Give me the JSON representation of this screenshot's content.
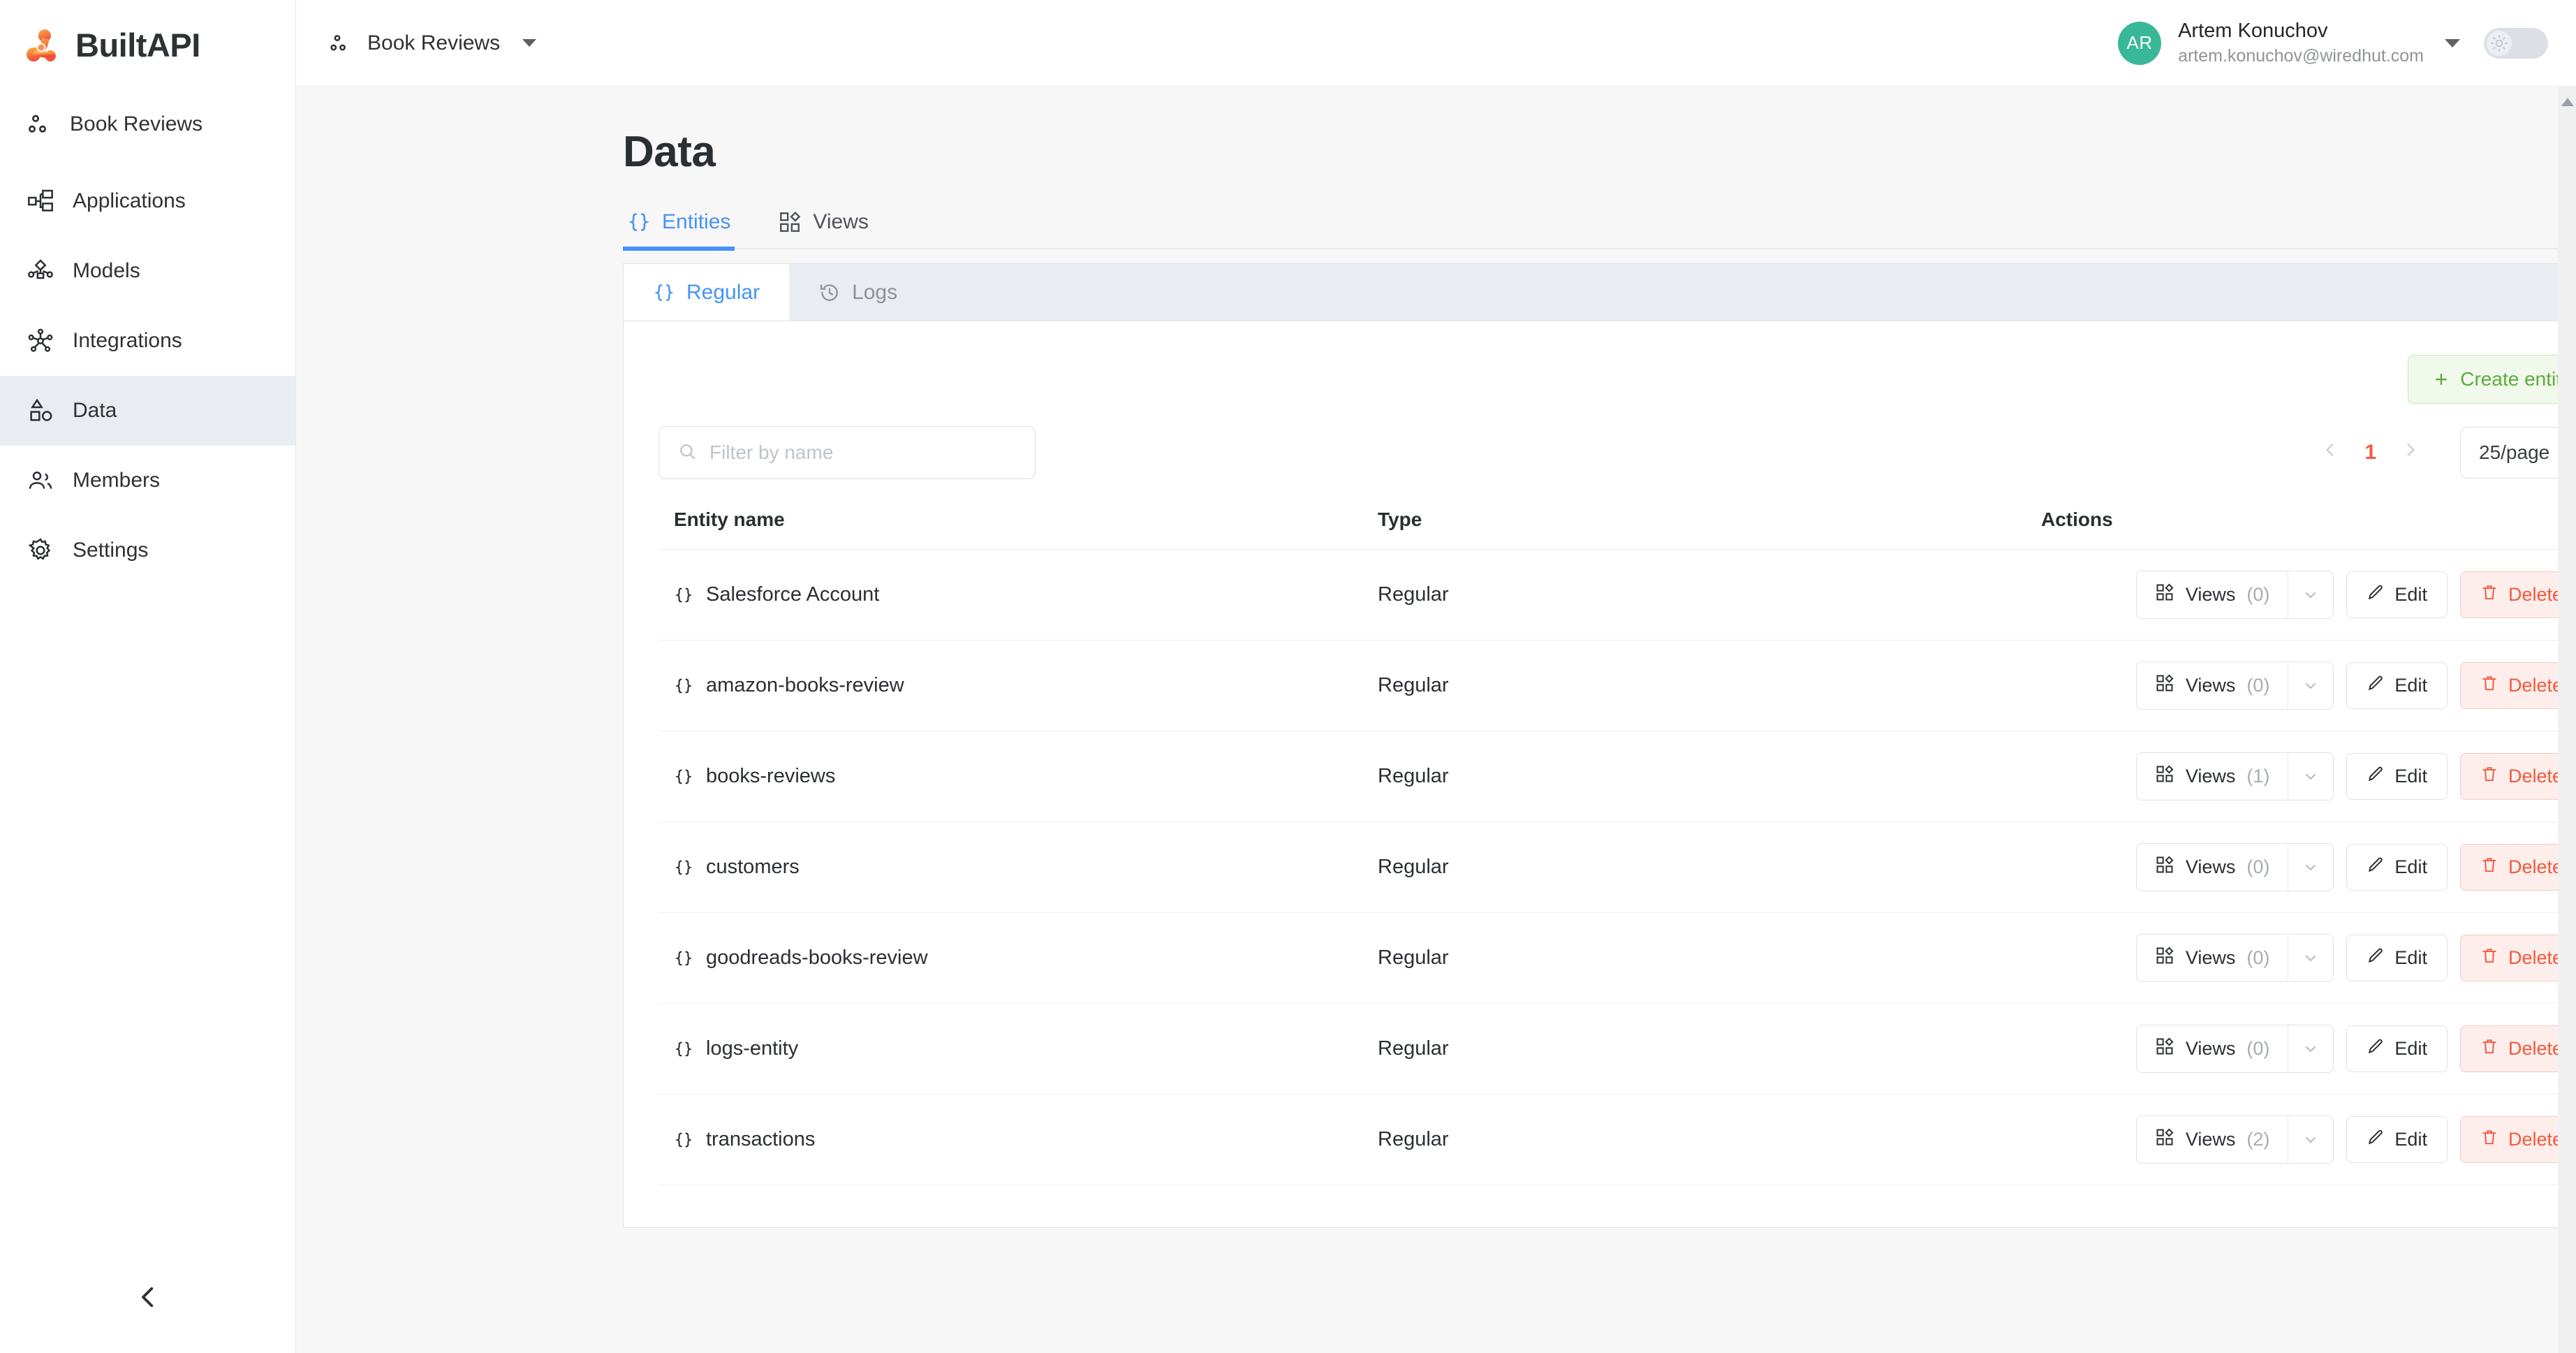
{
  "brand": {
    "name": "BuiltAPI",
    "logo_icon": "molecule-icon"
  },
  "sidebar": {
    "project": {
      "label": "Book Reviews",
      "icon": "nodes-icon"
    },
    "items": [
      {
        "label": "Applications",
        "icon": "applications-icon",
        "active": false
      },
      {
        "label": "Models",
        "icon": "models-icon",
        "active": false
      },
      {
        "label": "Integrations",
        "icon": "integrations-icon",
        "active": false
      },
      {
        "label": "Data",
        "icon": "data-icon",
        "active": true
      },
      {
        "label": "Members",
        "icon": "members-icon",
        "active": false
      },
      {
        "label": "Settings",
        "icon": "gear-icon",
        "active": false
      }
    ],
    "collapse_icon": "chevron-left-icon"
  },
  "topbar": {
    "project_switcher": {
      "label": "Book Reviews",
      "icon": "nodes-icon",
      "caret": "caret-down-icon"
    },
    "user": {
      "initials": "AR",
      "name": "Artem Konuchov",
      "email": "artem.konuchov@wiredhut.com",
      "avatar_color": "#38b897",
      "caret": "caret-down-icon"
    },
    "theme_toggle": {
      "icon": "sun-icon",
      "state": "off"
    }
  },
  "page": {
    "title": "Data",
    "tabs": [
      {
        "label": "Entities",
        "icon": "braces-icon",
        "active": true
      },
      {
        "label": "Views",
        "icon": "grid-icon",
        "active": false
      }
    ],
    "subtabs": [
      {
        "label": "Regular",
        "icon": "braces-icon",
        "active": true
      },
      {
        "label": "Logs",
        "icon": "history-icon",
        "active": false
      }
    ]
  },
  "toolbar": {
    "create_label": "Create entity",
    "create_plus": "+",
    "search": {
      "placeholder": "Filter by name",
      "value": "",
      "icon": "search-icon"
    },
    "pagination": {
      "prev_icon": "chevron-left-icon",
      "next_icon": "chevron-right-icon",
      "current_page": "1",
      "page_size": "25/page",
      "page_size_caret": "chevron-down-icon"
    }
  },
  "table": {
    "columns": [
      "Entity name",
      "Type",
      "Actions"
    ],
    "action_labels": {
      "views": "Views",
      "edit": "Edit",
      "delete": "Delete"
    },
    "rows": [
      {
        "name": "Salesforce Account",
        "type": "Regular",
        "views": "(0)"
      },
      {
        "name": "amazon-books-review",
        "type": "Regular",
        "views": "(0)"
      },
      {
        "name": "books-reviews",
        "type": "Regular",
        "views": "(1)"
      },
      {
        "name": "customers",
        "type": "Regular",
        "views": "(0)"
      },
      {
        "name": "goodreads-books-review",
        "type": "Regular",
        "views": "(0)"
      },
      {
        "name": "logs-entity",
        "type": "Regular",
        "views": "(0)"
      },
      {
        "name": "transactions",
        "type": "Regular",
        "views": "(2)"
      }
    ]
  },
  "colors": {
    "accent_blue": "#4593f5",
    "accent_orange": "#f05a3c",
    "success_green": "#5daa3d",
    "avatar_green": "#38b897",
    "sidebar_active": "#e9edf1"
  }
}
